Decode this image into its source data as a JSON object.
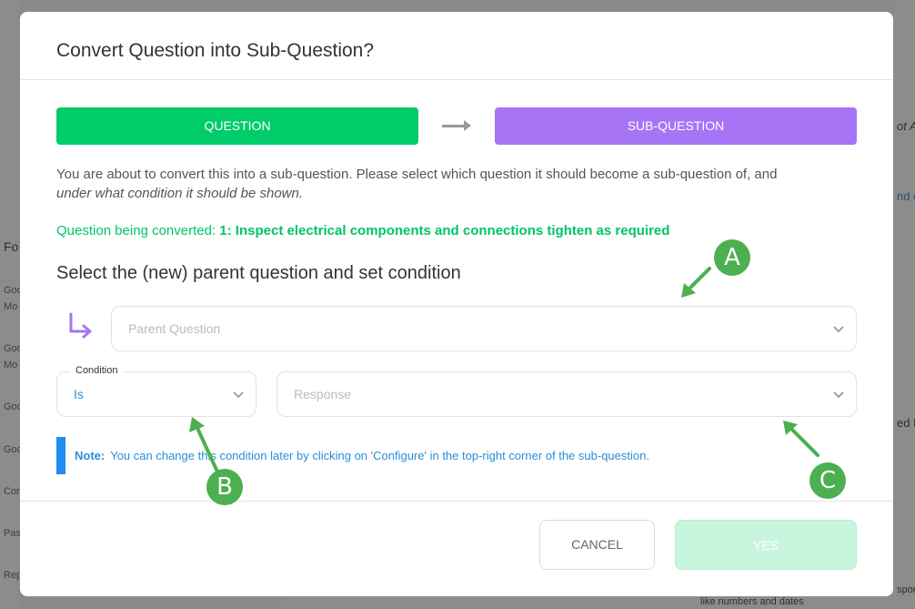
{
  "background": {
    "left_header": "Fo",
    "left_items": [
      "Goo",
      "Mo",
      "Goo",
      "Mo",
      "Goo",
      "Goo",
      "Con",
      "Pas",
      "Rep"
    ],
    "right_texts": [
      "ot An",
      "nd c",
      "ed R",
      "spon"
    ],
    "bottom_text": "like numbers and dates"
  },
  "modal": {
    "title": "Convert Question into Sub-Question?",
    "step_question": "QUESTION",
    "step_subquestion": "SUB-QUESTION",
    "intro_text": "You are about to convert this into a sub-question. Please select which question it should become a sub-question of, and",
    "intro_italic": "under what condition it should be shown.",
    "converting_label": "Question being converted:",
    "converting_value": "1: Inspect electrical components and connections tighten as required",
    "section_title": "Select the (new) parent question and set condition",
    "parent_placeholder": "Parent Question",
    "condition_label": "Condition",
    "condition_value": "Is",
    "response_placeholder": "Response",
    "note_label": "Note:",
    "note_text": "You can change this condition later by clicking on 'Configure' in the top-right corner of the sub-question.",
    "cancel_label": "CANCEL",
    "yes_label": "YES"
  },
  "annotations": {
    "a": "A",
    "b": "B",
    "c": "C"
  },
  "colors": {
    "question_green": "#00cc6a",
    "subquestion_purple": "#a774f5",
    "note_blue": "#1e8cf0",
    "annotation_green": "#4caf50"
  }
}
